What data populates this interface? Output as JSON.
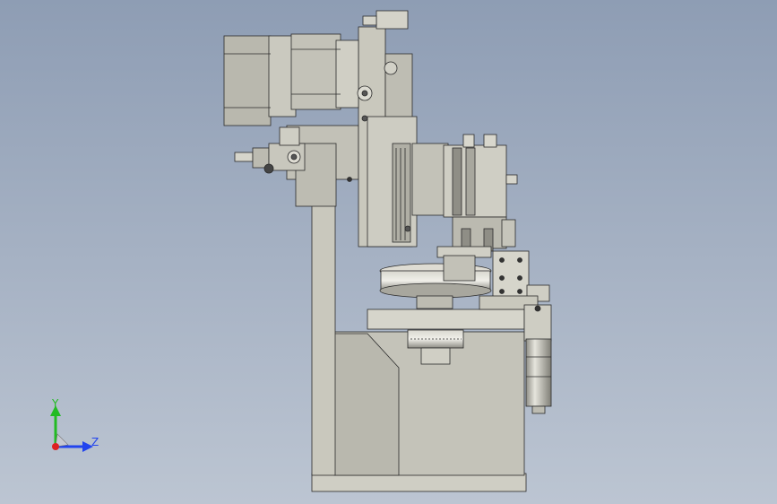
{
  "viewport": {
    "background_top": "#8e9db4",
    "background_bottom": "#bcc5d2"
  },
  "colors": {
    "part_fill": "#c9c8bd",
    "part_fill_light": "#dcdbd2",
    "part_fill_dark": "#a9a89e",
    "edge": "#2b2b2b",
    "motor_fill": "#b9b8ae"
  },
  "triad": {
    "y_label": "Y",
    "z_label": "Z",
    "y_color": "#22bb22",
    "z_color": "#2244ee",
    "x_color": "#dd2222"
  }
}
